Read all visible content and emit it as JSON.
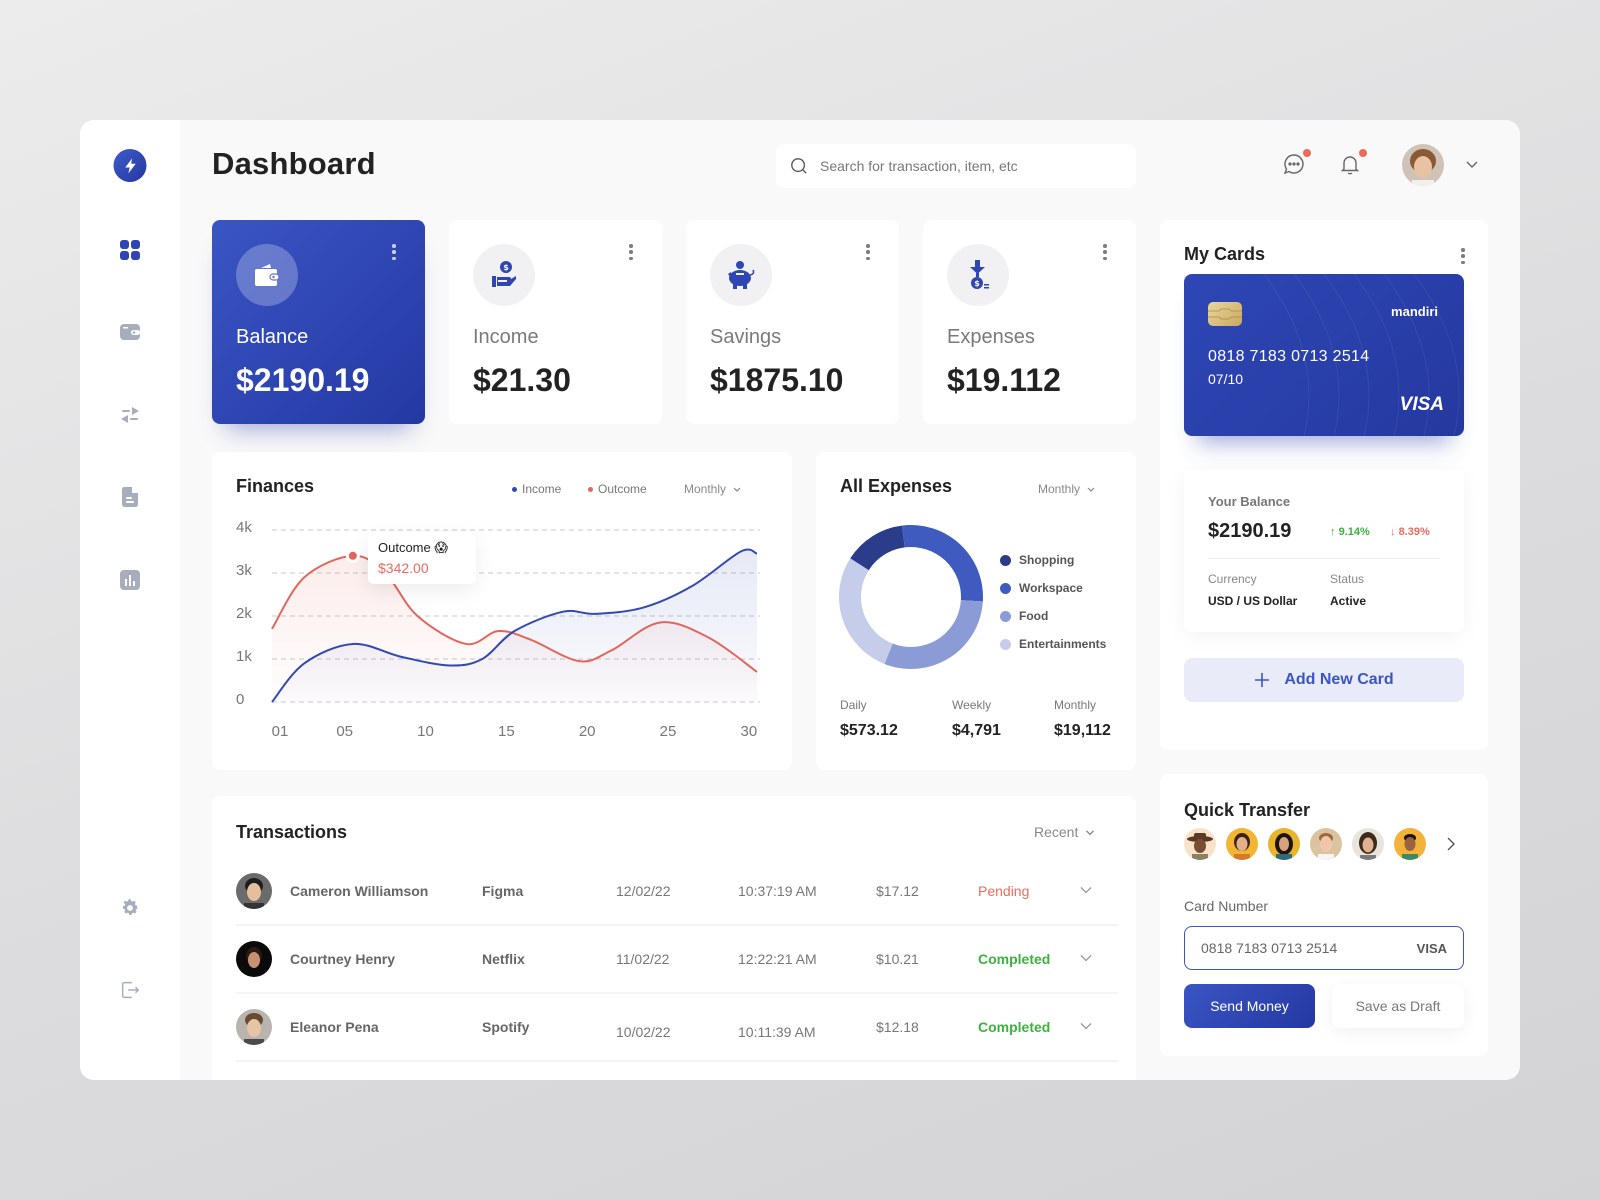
{
  "header": {
    "title": "Dashboard",
    "search_placeholder": "Search for transaction, item, etc",
    "icons": [
      "chat-icon",
      "bell-icon"
    ],
    "has_notifications": true
  },
  "sidebar": {
    "logo": "bolt-logo",
    "items": [
      {
        "name": "dashboard",
        "icon": "grid-icon",
        "active": true
      },
      {
        "name": "wallet",
        "icon": "wallet-icon",
        "active": false
      },
      {
        "name": "transfer",
        "icon": "transfer-icon",
        "active": false
      },
      {
        "name": "documents",
        "icon": "document-icon",
        "active": false
      },
      {
        "name": "reports",
        "icon": "chart-icon",
        "active": false
      }
    ],
    "bottom": [
      {
        "name": "settings",
        "icon": "gear-icon"
      },
      {
        "name": "logout",
        "icon": "logout-icon"
      }
    ]
  },
  "stats": [
    {
      "label": "Balance",
      "value": "$2190.19",
      "icon": "wallet-icon",
      "primary": true
    },
    {
      "label": "Income",
      "value": "$21.30",
      "icon": "hand-coin-icon",
      "primary": false
    },
    {
      "label": "Savings",
      "value": "$1875.10",
      "icon": "piggy-bank-icon",
      "primary": false
    },
    {
      "label": "Expenses",
      "value": "$19.112",
      "icon": "coin-down-icon",
      "primary": false
    }
  ],
  "finances": {
    "title": "Finances",
    "legend": [
      "Income",
      "Outcome"
    ],
    "period": "Monthly",
    "tooltip": {
      "label": "Outcome 😱",
      "value": "$342.00"
    }
  },
  "expenses": {
    "title": "All Expenses",
    "period": "Monthly",
    "legend": [
      "Shopping",
      "Workspace",
      "Food",
      "Entertainments"
    ],
    "summary": [
      {
        "label": "Daily",
        "value": "$573.12"
      },
      {
        "label": "Weekly",
        "value": "$4,791"
      },
      {
        "label": "Monthly",
        "value": "$19,112"
      }
    ]
  },
  "chart_data": [
    {
      "type": "line",
      "title": "Finances",
      "xlabel": "",
      "ylabel": "",
      "x": [
        1,
        5,
        10,
        15,
        20,
        25,
        30
      ],
      "x_tick_labels": [
        "01",
        "05",
        "10",
        "15",
        "20",
        "25",
        "30"
      ],
      "y_tick_labels": [
        "0",
        "1k",
        "2k",
        "3k",
        "4k"
      ],
      "ylim": [
        0,
        4000
      ],
      "xlim": [
        1,
        31
      ],
      "grid": true,
      "legend_position": "top-right",
      "series": [
        {
          "name": "Income",
          "color": "#3249b3",
          "points": [
            [
              1,
              0
            ],
            [
              3,
              900
            ],
            [
              6,
              1350
            ],
            [
              9,
              1050
            ],
            [
              12,
              850
            ],
            [
              14,
              1000
            ],
            [
              16,
              1650
            ],
            [
              19,
              2100
            ],
            [
              21,
              2050
            ],
            [
              24,
              2200
            ],
            [
              27,
              2700
            ],
            [
              30,
              3500
            ],
            [
              31,
              3450
            ]
          ]
        },
        {
          "name": "Outcome",
          "color": "#e2665c",
          "points": [
            [
              1,
              1700
            ],
            [
              3,
              2900
            ],
            [
              6,
              3400
            ],
            [
              8,
              3000
            ],
            [
              10,
              2000
            ],
            [
              13,
              1350
            ],
            [
              15,
              1650
            ],
            [
              17,
              1450
            ],
            [
              20,
              950
            ],
            [
              22,
              1200
            ],
            [
              25,
              1850
            ],
            [
              28,
              1500
            ],
            [
              31,
              700
            ]
          ]
        }
      ],
      "annotation": {
        "series": "Outcome",
        "x": 6,
        "label": "Outcome 😱",
        "value": "$342.00"
      }
    },
    {
      "type": "pie",
      "title": "All Expenses",
      "categories": [
        "Shopping",
        "Workspace",
        "Food",
        "Entertainments"
      ],
      "values": [
        14,
        28,
        30,
        28
      ],
      "colors": [
        "#2b3d8a",
        "#3f5bc0",
        "#8b9bd6",
        "#c5cdeb"
      ],
      "donut": true,
      "legend_position": "right"
    }
  ],
  "cards": {
    "title": "My Cards",
    "card": {
      "number": "0818 7183 0713 2514",
      "expiry": "07/10",
      "bank": "mandiri",
      "brand": "VISA"
    },
    "balance": {
      "label": "Your Balance",
      "value": "$2190.19",
      "up": "9.14%",
      "down": "8.39%",
      "currency_label": "Currency",
      "currency": "USD / US Dollar",
      "status_label": "Status",
      "status": "Active"
    },
    "add_label": "Add New Card"
  },
  "transfer": {
    "title": "Quick Transfer",
    "contacts": 6,
    "card_label": "Card Number",
    "card_value": "0818 7183 0713 2514",
    "card_brand": "VISA",
    "send_label": "Send Money",
    "draft_label": "Save as Draft"
  },
  "transactions": {
    "title": "Transactions",
    "sort": "Recent",
    "rows": [
      {
        "name": "Cameron Williamson",
        "app": "Figma",
        "date": "12/02/22",
        "time": "10:37:19 AM",
        "amount": "$17.12",
        "status": "Pending"
      },
      {
        "name": "Courtney Henry",
        "app": "Netflix",
        "date": "11/02/22",
        "time": "12:22:21 AM",
        "amount": "$10.21",
        "status": "Completed"
      },
      {
        "name": "Eleanor Pena",
        "app": "Spotify",
        "date": "10/02/22",
        "time": "10:11:39 AM",
        "amount": "$12.18",
        "status": "Completed"
      }
    ]
  },
  "colors": {
    "accent": "#3a55c4",
    "income": "#3249b3",
    "outcome": "#e2665c",
    "positive": "#3cb43c",
    "negative": "#ec6a5e"
  }
}
